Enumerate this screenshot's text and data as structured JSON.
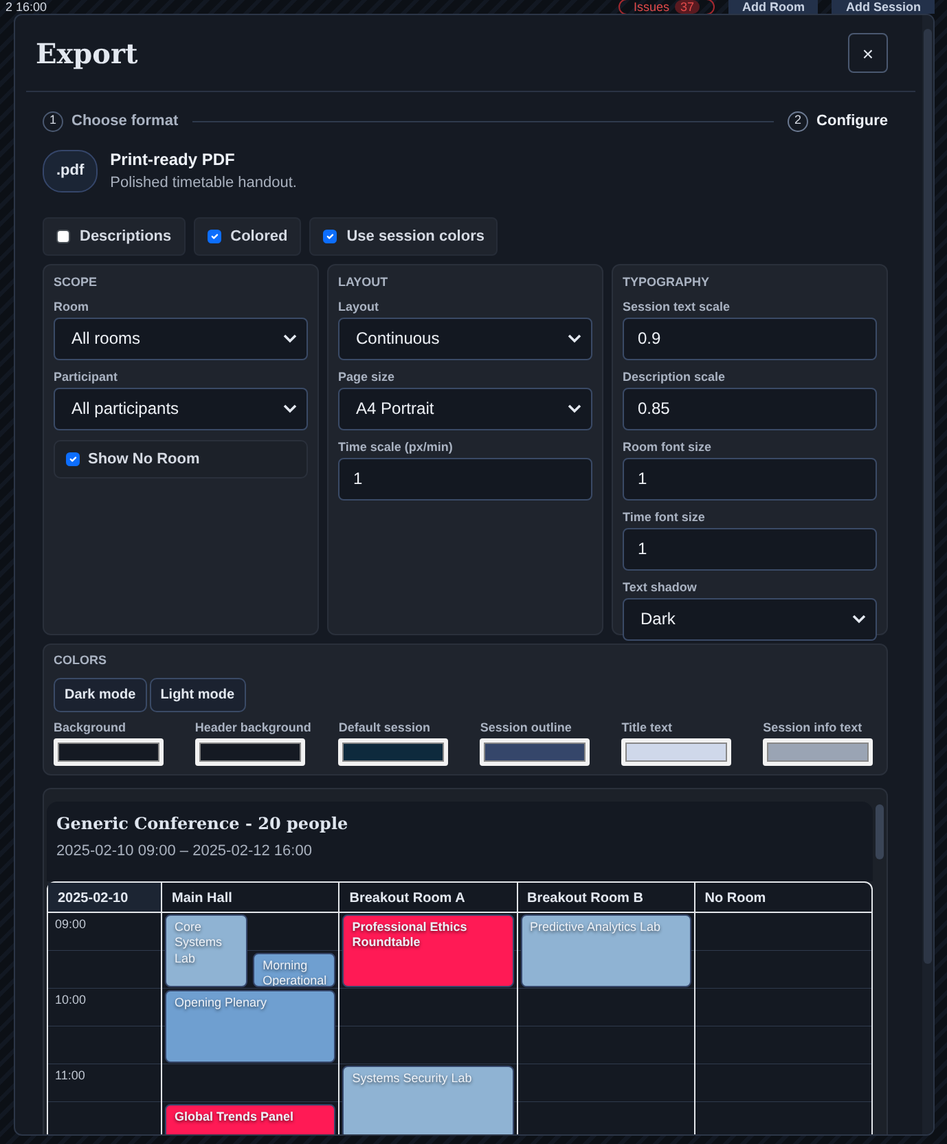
{
  "app_bar": {
    "date_text": "2 16:00",
    "issues": {
      "label": "Issues",
      "count": "37"
    },
    "buttons": [
      "Add Room",
      "Add Session"
    ]
  },
  "dialog": {
    "title": "Export",
    "close": "×"
  },
  "steps": [
    {
      "number": "1",
      "label": "Choose format",
      "selected": false
    },
    {
      "number": "2",
      "label": "Configure",
      "selected": true
    }
  ],
  "format": {
    "badge": ".pdf",
    "name": "Print-ready PDF",
    "description": "Polished timetable handout."
  },
  "options": [
    {
      "label": "Descriptions",
      "checked": false
    },
    {
      "label": "Colored",
      "checked": true
    },
    {
      "label": "Use session colors",
      "checked": true
    }
  ],
  "panels": [
    {
      "heading": "SCOPE",
      "fields": [
        {
          "kind": "select",
          "label": "Room",
          "value": "All rooms"
        },
        {
          "kind": "select",
          "label": "Participant",
          "value": "All participants"
        },
        {
          "kind": "checkbox",
          "label": "Show No Room",
          "checked": true
        }
      ]
    },
    {
      "heading": "LAYOUT",
      "fields": [
        {
          "kind": "select",
          "label": "Layout",
          "value": "Continuous"
        },
        {
          "kind": "select",
          "label": "Page size",
          "value": "A4 Portrait"
        },
        {
          "kind": "input",
          "label": "Time scale (px/min)",
          "value": "1"
        }
      ]
    },
    {
      "heading": "TYPOGRAPHY",
      "fields": [
        {
          "kind": "input",
          "label": "Session text scale",
          "value": "0.9"
        },
        {
          "kind": "input",
          "label": "Description scale",
          "value": "0.85"
        },
        {
          "kind": "input",
          "label": "Room font size",
          "value": "1"
        },
        {
          "kind": "input",
          "label": "Time font size",
          "value": "1"
        },
        {
          "kind": "select",
          "label": "Text shadow",
          "value": "Dark"
        }
      ]
    }
  ],
  "colors": {
    "heading": "COLORS",
    "presets": [
      "Dark mode",
      "Light mode"
    ],
    "swatches": [
      {
        "label": "Background",
        "color": "#151a23"
      },
      {
        "label": "Header background",
        "color": "#151a23"
      },
      {
        "label": "Default session",
        "color": "#0e2a3d"
      },
      {
        "label": "Session outline",
        "color": "#35466a"
      },
      {
        "label": "Title text",
        "color": "#cfd8ea"
      },
      {
        "label": "Session info text",
        "color": "#9aa4b4"
      }
    ]
  },
  "preview": {
    "title": "Generic Conference - 20 people",
    "range": "2025-02-10 09:00 – 2025-02-12 16:00",
    "date": "2025-02-10",
    "times": [
      "09:00",
      "10:00",
      "11:00"
    ],
    "rooms": [
      {
        "name": "Main Hall",
        "sessions": [
          {
            "title": "Core Systems Lab",
            "color": "#8fb3d3"
          },
          {
            "title": "Morning Operational",
            "color": "#6f9fd0"
          },
          {
            "title": "Opening Plenary",
            "color": "#6f9fd0"
          },
          {
            "title": "Global Trends Panel",
            "color": "#ff1a55"
          }
        ]
      },
      {
        "name": "Breakout Room A",
        "sessions": [
          {
            "title": "Professional Ethics Roundtable",
            "color": "#ff1a55"
          },
          {
            "title": "Systems Security Lab",
            "color": "#8fb3d3"
          }
        ]
      },
      {
        "name": "Breakout Room B",
        "sessions": [
          {
            "title": "Predictive Analytics Lab",
            "color": "#8fb3d3"
          }
        ]
      },
      {
        "name": "No Room"
      }
    ]
  }
}
